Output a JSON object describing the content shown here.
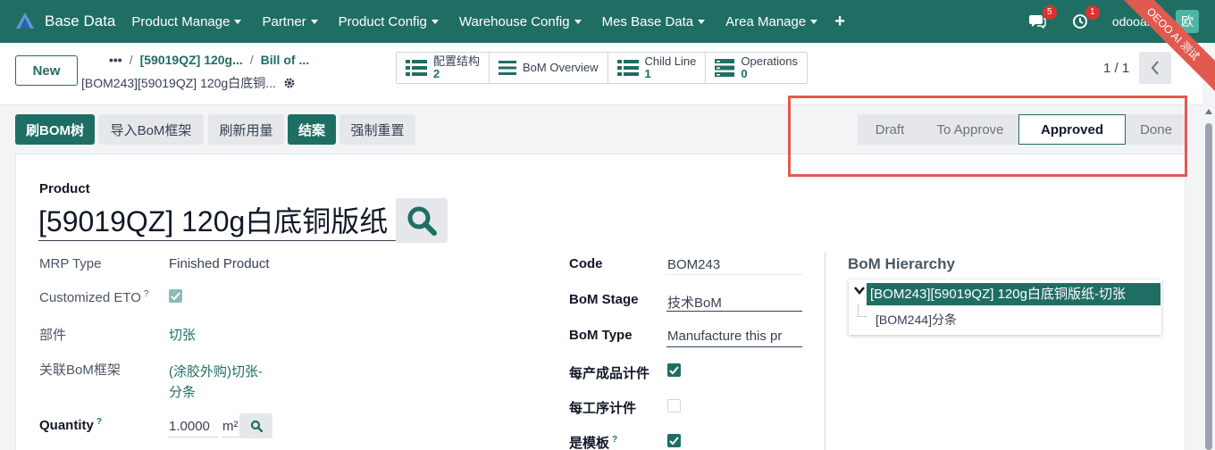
{
  "navbar": {
    "brand": "Base Data",
    "menu": [
      "Product Manage",
      "Partner",
      "Product Config",
      "Warehouse Config",
      "Mes Base Data",
      "Area Manage"
    ],
    "messages_count": "5",
    "activities_count": "1",
    "user": "odooaron",
    "avatar": "欧",
    "ribbon": "OEOO AI 测试"
  },
  "control": {
    "new_label": "New",
    "breadcrumb": [
      "•••",
      "[59019QZ] 120g...",
      "Bill of ..."
    ],
    "record_title": "[BOM243][59019QZ] 120g白底铜...",
    "smart_buttons": [
      {
        "label": "配置结构",
        "count": "2",
        "icon": "list-icon"
      },
      {
        "label": "BoM Overview",
        "count": "",
        "icon": "menu-icon"
      },
      {
        "label": "Child Line",
        "count": "1",
        "icon": "list-icon"
      },
      {
        "label": "Operations",
        "count": "0",
        "icon": "operations-icon"
      }
    ],
    "pager": "1 / 1"
  },
  "actions": {
    "refresh_tree": "刷BOM树",
    "import_frame": "导入BoM框架",
    "refresh_usage": "刷新用量",
    "close_case": "结案",
    "force_reset": "强制重置"
  },
  "status_bar": {
    "stages": [
      "Draft",
      "To Approve",
      "Approved",
      "Done"
    ],
    "active": "Approved"
  },
  "form": {
    "product_label": "Product",
    "product_value": "[59019QZ] 120g白底铜版纸",
    "mrp_type_label": "MRP Type",
    "mrp_type_value": "Finished Product",
    "customized_eto_label": "Customized ETO",
    "part_label": "部件",
    "part_value": "切张",
    "related_frame_label": "关联BoM框架",
    "related_frame_value_1": "(涂胶外购)切张-",
    "related_frame_value_2": "分条",
    "quantity_label": "Quantity",
    "quantity_value": "1.0000",
    "quantity_uom": "m²",
    "code_label": "Code",
    "code_value": "BOM243",
    "stage_label": "BoM Stage",
    "stage_value": "技术BoM",
    "bom_type_label": "BoM Type",
    "bom_type_value": "Manufacture this pr",
    "per_product_label": "每产成品计件",
    "per_product_checked": true,
    "per_operation_label": "每工序计件",
    "per_operation_checked": false,
    "is_template_label": "是模板",
    "is_template_checked": true
  },
  "hierarchy": {
    "title": "BoM Hierarchy",
    "root": "[BOM243][59019QZ] 120g白底铜版纸-切张",
    "child": "[BOM244]分条"
  },
  "colors": {
    "brand": "#1f6e63",
    "highlight": "#e05a4f",
    "badge": "#e03131"
  }
}
